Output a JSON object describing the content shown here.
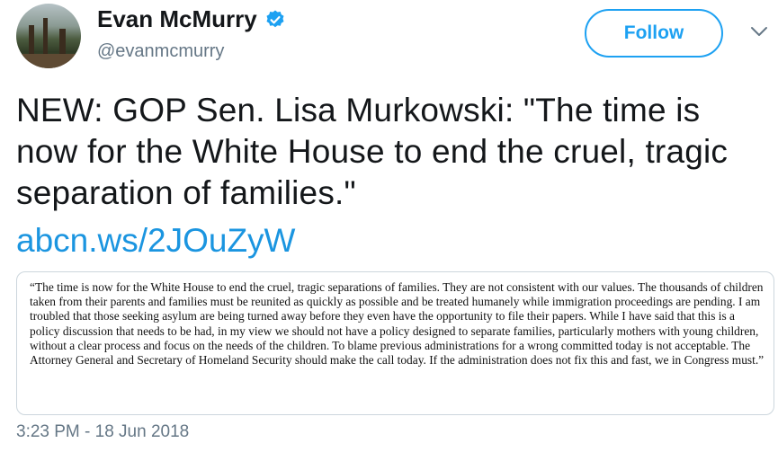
{
  "author": {
    "display_name": "Evan McMurry",
    "handle": "@evanmcmurry",
    "verified": true,
    "avatar_icon": "profile-photo-trees"
  },
  "actions": {
    "follow_label": "Follow",
    "more_icon": "chevron-down-icon"
  },
  "tweet": {
    "text": "NEW: GOP Sen. Lisa Murkowski: \"The time is now for the White House to end the cruel, tragic separation of families.\"",
    "link_text": "abcn.ws/2JOuZyW",
    "quote_text": "“The time is now for the White House to end the cruel, tragic separations of families. They are not consistent with our values. The thousands of children taken from their parents and families must be reunited as quickly as possible and be treated humanely while immigration proceedings are pending. I am troubled that those seeking asylum are being turned away before they even have the opportunity to file their papers. While I have said that this is a policy discussion that needs to be had, in my view we should not have a policy designed to separate families, particularly mothers with young children, without a clear process and focus on the needs of the children. To blame previous administrations for a wrong committed today is not acceptable. The Attorney General and Secretary of Homeland Security should make the call today. If the administration does not fix this and fast, we in Congress must.”",
    "timestamp": "3:23 PM - 18 Jun 2018"
  },
  "colors": {
    "accent": "#1da1f2",
    "link": "#1b95e0",
    "muted": "#657786",
    "text": "#14171a"
  }
}
